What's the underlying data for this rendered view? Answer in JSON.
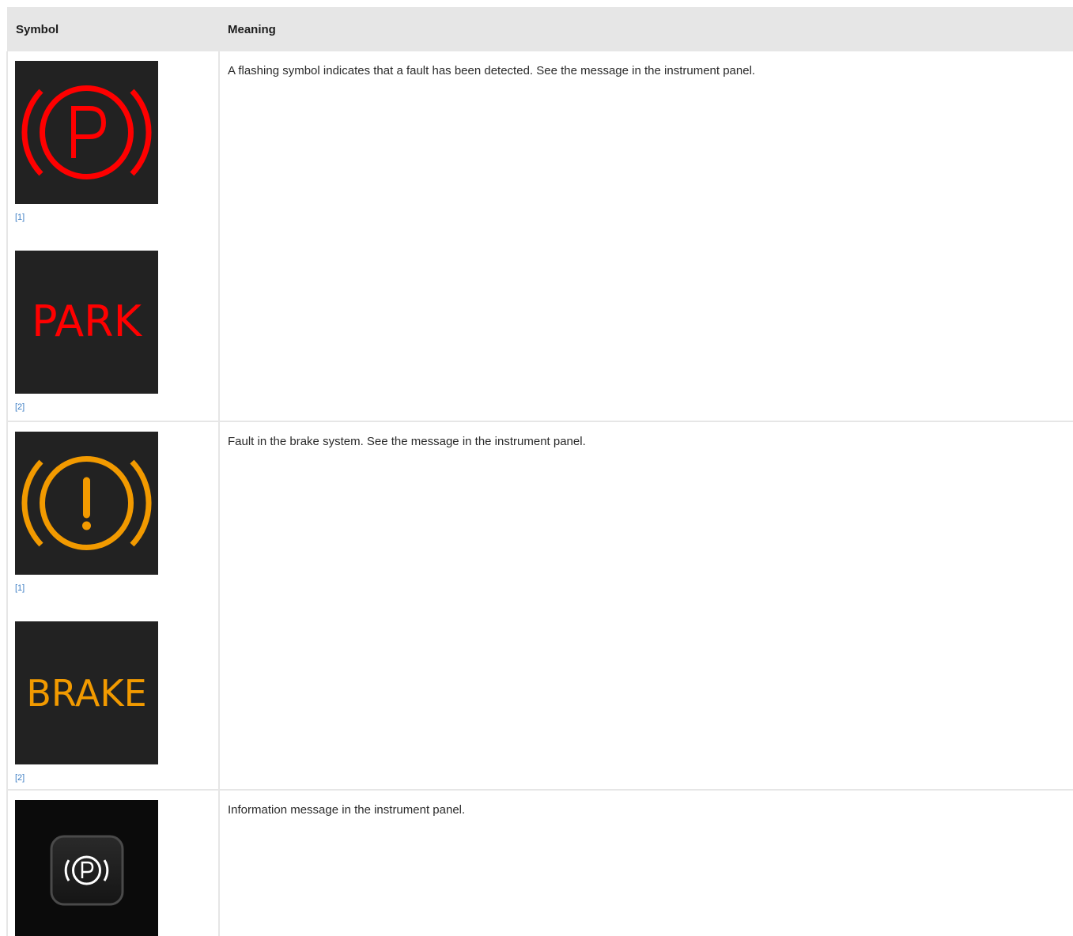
{
  "table": {
    "headers": {
      "symbol": "Symbol",
      "meaning": "Meaning"
    },
    "rows": [
      {
        "meaning": "A flashing symbol indicates that a fault has been detected. See the message in the instrument panel.",
        "symbols": [
          {
            "icon": "parking-brake-red-icon",
            "ref": "[1]"
          },
          {
            "icon": "park-text-red-icon",
            "text": "PARK",
            "ref": "[2]"
          }
        ]
      },
      {
        "meaning": "Fault in the brake system. See the message in the instrument panel.",
        "symbols": [
          {
            "icon": "brake-warning-amber-icon",
            "ref": "[1]"
          },
          {
            "icon": "brake-text-amber-icon",
            "text": "BRAKE",
            "ref": "[2]"
          }
        ]
      },
      {
        "meaning": "Information message in the instrument panel.",
        "symbols": [
          {
            "icon": "parking-brake-info-white-icon"
          }
        ]
      }
    ]
  },
  "colors": {
    "red": "#ff0000",
    "amber": "#f29a00",
    "header_bg": "#e6e6e6",
    "link": "#3f7fc4"
  }
}
